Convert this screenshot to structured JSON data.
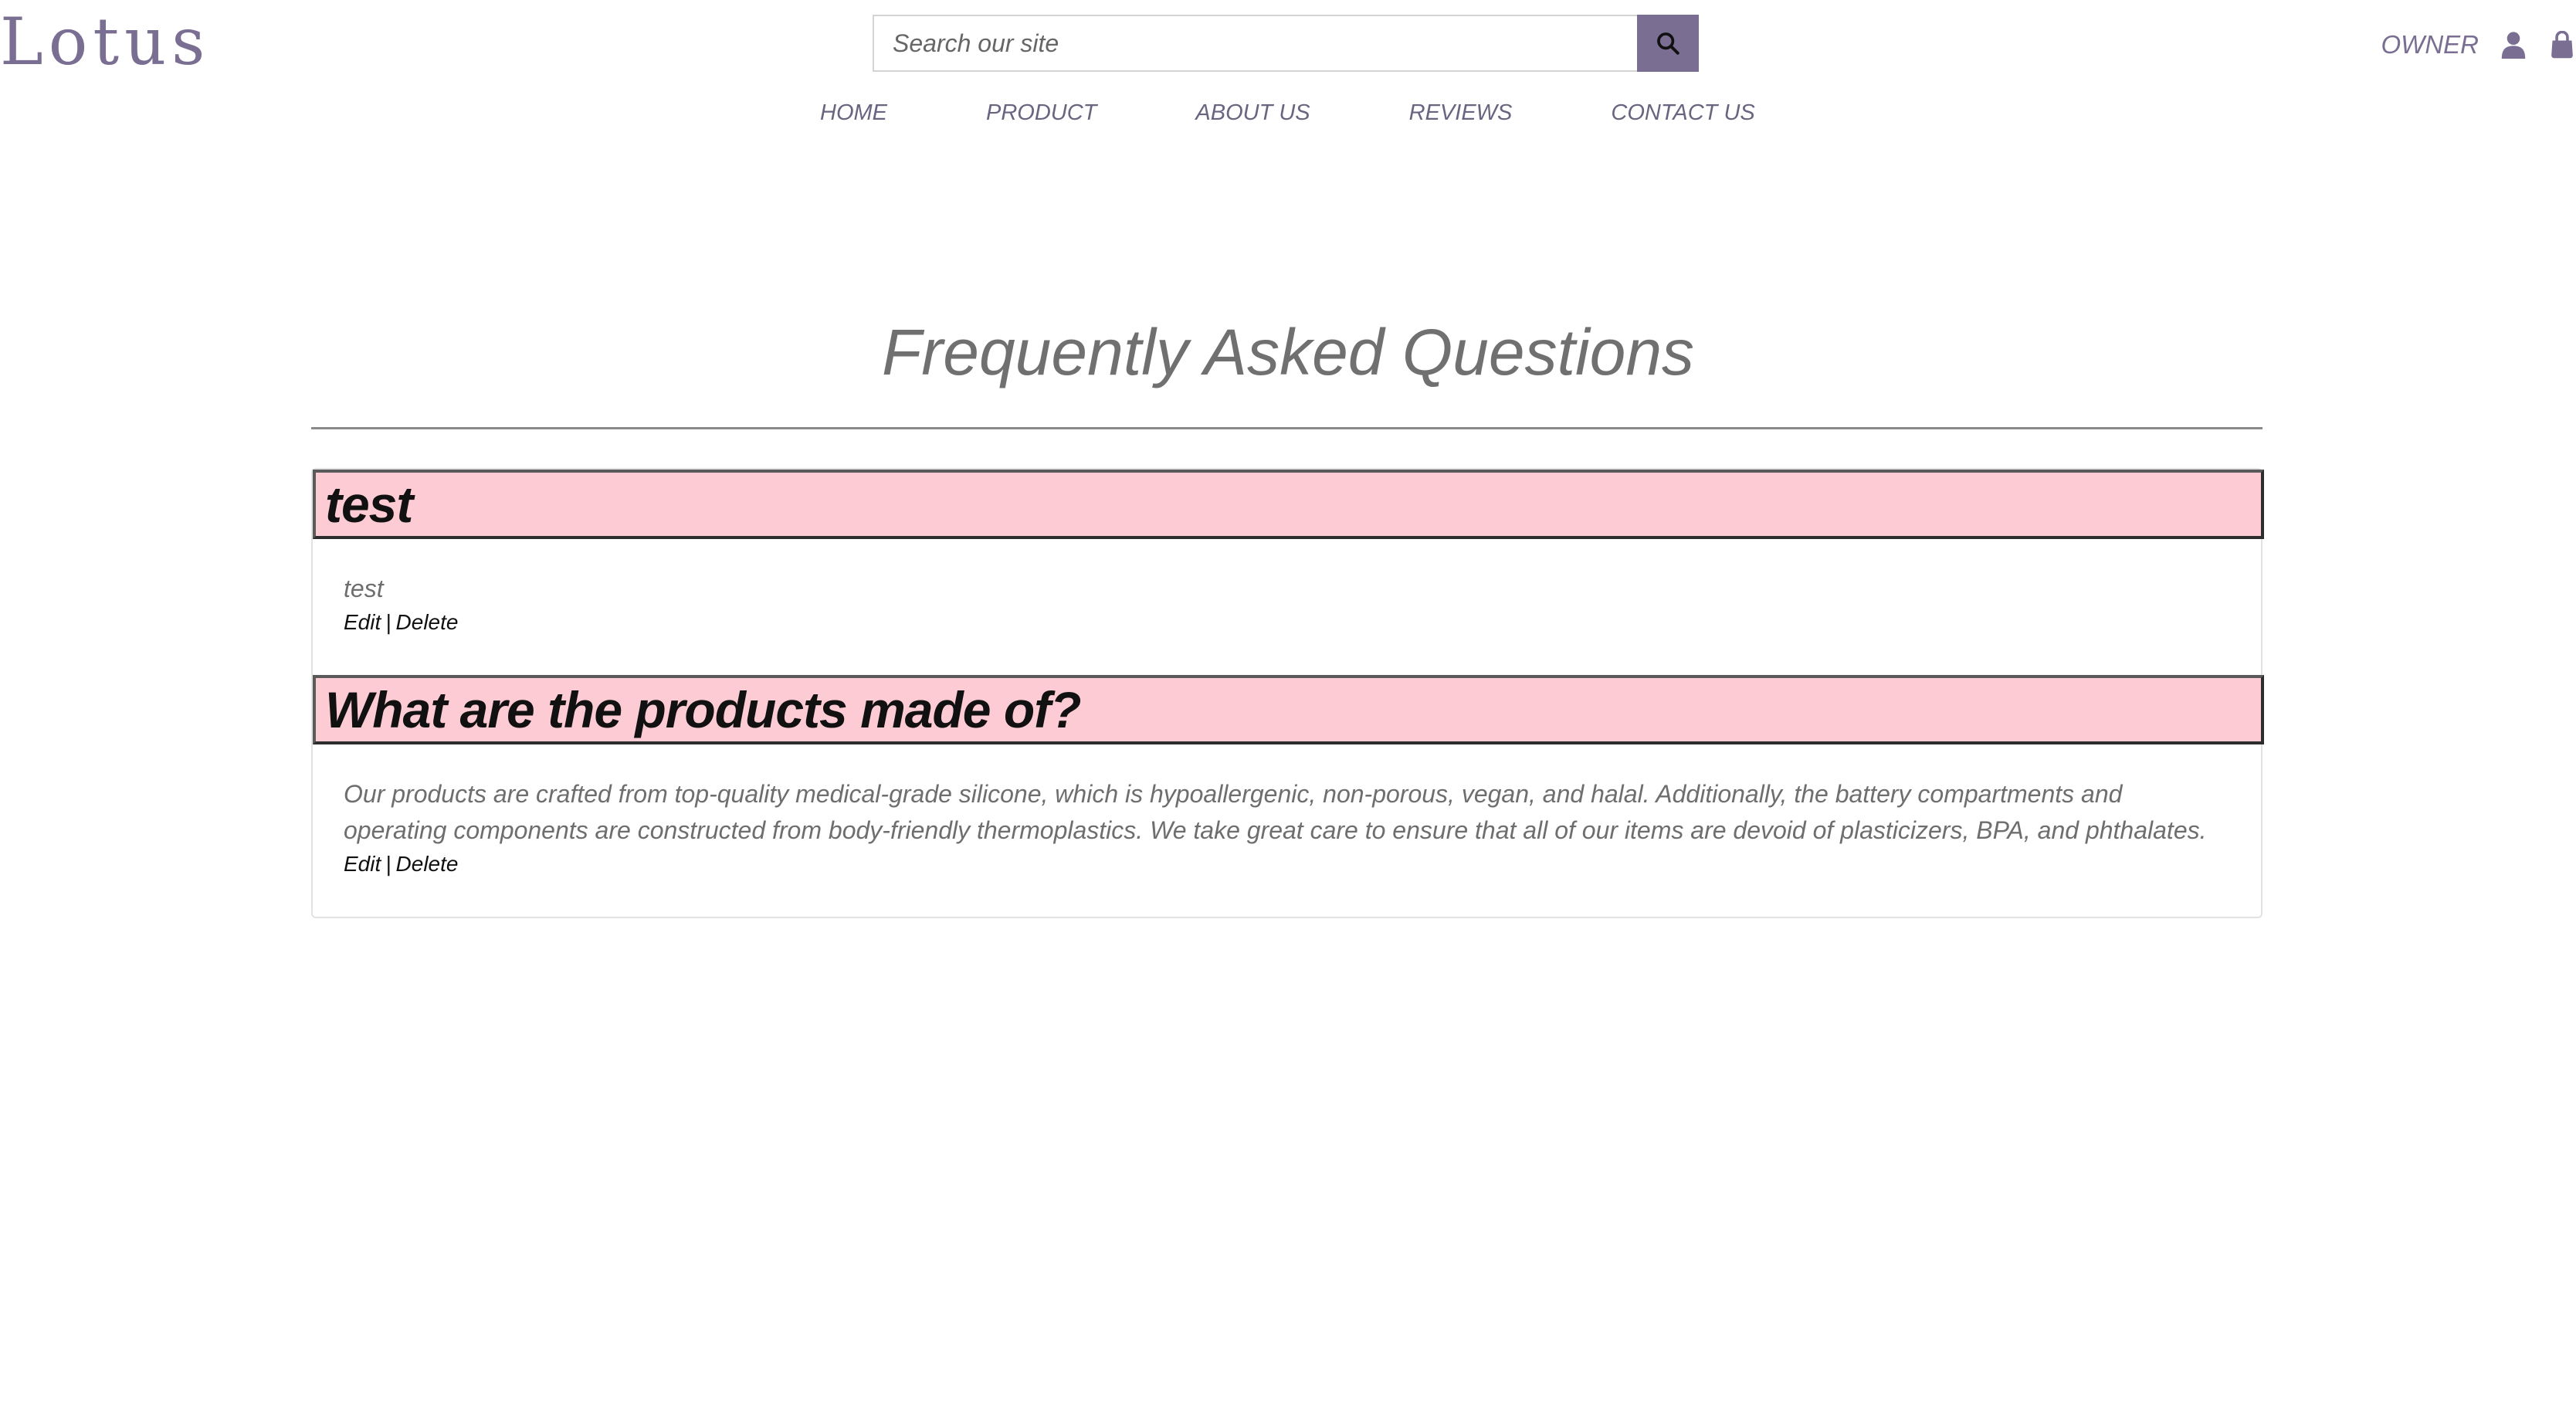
{
  "header": {
    "logo": "Lotus",
    "search": {
      "placeholder": "Search our site",
      "button_icon": "search-icon"
    },
    "user": {
      "label": "OWNER",
      "user_icon": "person-icon",
      "bag_icon": "shopping-bag-icon"
    },
    "nav": [
      {
        "label": "HOME"
      },
      {
        "label": "PRODUCT"
      },
      {
        "label": "ABOUT US"
      },
      {
        "label": "REVIEWS"
      },
      {
        "label": "CONTACT US"
      }
    ]
  },
  "main": {
    "title": "Frequently Asked Questions",
    "faqs": [
      {
        "question": "test",
        "answer": "test",
        "edit_label": "Edit",
        "separator": "|",
        "delete_label": "Delete"
      },
      {
        "question": "What are the products made of?",
        "answer": "Our products are crafted from top-quality medical-grade silicone, which is hypoallergenic, non-porous, vegan, and halal. Additionally, the battery compartments and operating components are constructed from body-friendly thermoplastics. We take great care to ensure that all of our items are devoid of plasticizers, BPA, and phthalates.",
        "edit_label": "Edit",
        "separator": "|",
        "delete_label": "Delete"
      }
    ]
  },
  "colors": {
    "brand": "#7a6f92",
    "question_bg": "#fdcbd3",
    "question_border": "#2d2d2d",
    "text_muted": "#6e6e6e"
  }
}
